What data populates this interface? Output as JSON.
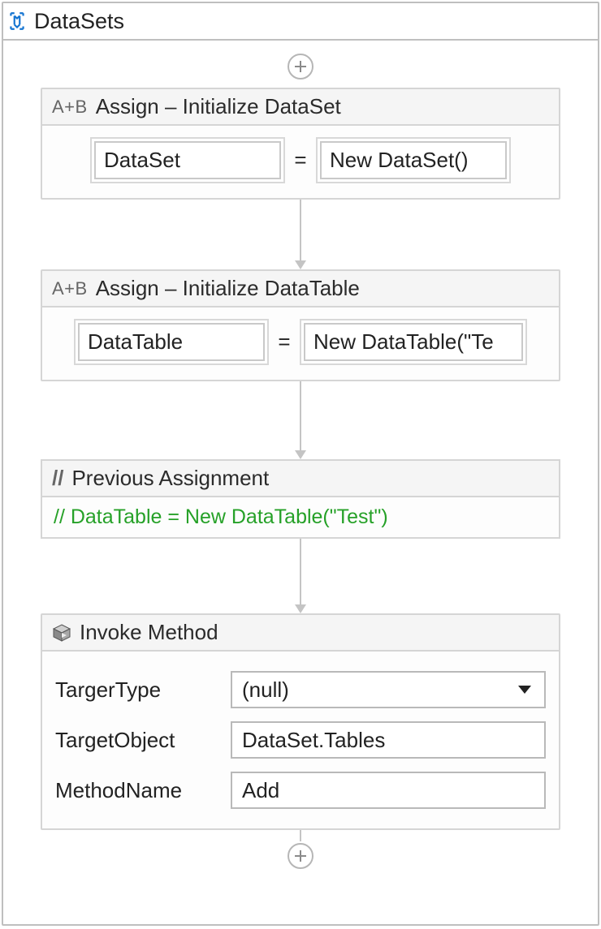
{
  "root": {
    "title": "DataSets"
  },
  "activities": {
    "assign1": {
      "icon_label": "A+B",
      "title": "Assign – Initialize DataSet",
      "left": "DataSet",
      "equals": "=",
      "right": "New DataSet()"
    },
    "assign2": {
      "icon_label": "A+B",
      "title": "Assign – Initialize DataTable",
      "left": "DataTable",
      "equals": "=",
      "right": "New DataTable(\"Te"
    },
    "comment": {
      "icon_label": "//",
      "title": "Previous Assignment",
      "text": "// DataTable = New DataTable(\"Test\")"
    },
    "invoke": {
      "title": "Invoke Method",
      "rows": {
        "targer_type": {
          "label": "TargerType",
          "value": "(null)"
        },
        "target_object": {
          "label": "TargetObject",
          "value": "DataSet.Tables"
        },
        "method_name": {
          "label": "MethodName",
          "value": "Add"
        }
      }
    }
  }
}
